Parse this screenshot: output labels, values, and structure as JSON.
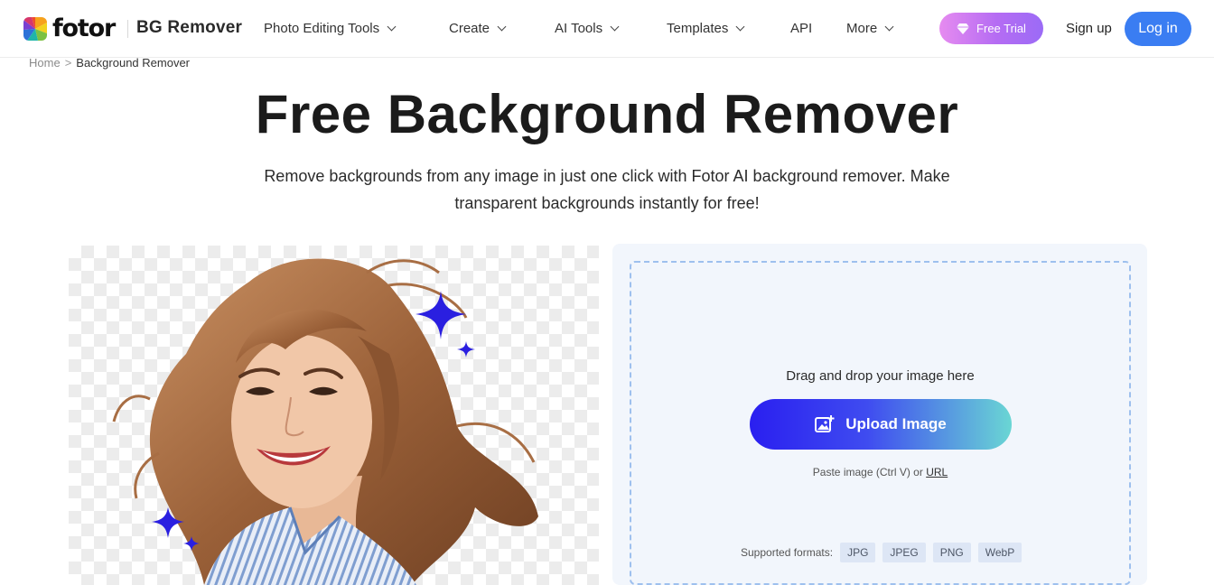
{
  "header": {
    "logo_text": "fotor",
    "product_name": "BG Remover",
    "nav": [
      {
        "label": "Photo Editing Tools",
        "has_dropdown": true
      },
      {
        "label": "Create",
        "has_dropdown": true
      },
      {
        "label": "AI Tools",
        "has_dropdown": true
      },
      {
        "label": "Templates",
        "has_dropdown": true
      },
      {
        "label": "API",
        "has_dropdown": false
      },
      {
        "label": "More",
        "has_dropdown": true
      }
    ],
    "free_trial_label": "Free Trial",
    "signup_label": "Sign up",
    "login_label": "Log in"
  },
  "breadcrumb": {
    "home": "Home",
    "separator": ">",
    "current": "Background Remover"
  },
  "hero": {
    "title": "Free Background Remover",
    "subtitle_line1": "Remove backgrounds from any image in just one click with Fotor AI background remover. Make",
    "subtitle_line2": "transparent backgrounds instantly for free!"
  },
  "upload": {
    "drag_text": "Drag and drop your image here",
    "button_label": "Upload Image",
    "paste_text": "Paste image (Ctrl V) or",
    "url_link": "URL",
    "formats_label": "Supported formats:",
    "formats": [
      "JPG",
      "JPEG",
      "PNG",
      "WebP"
    ]
  },
  "colors": {
    "login": "#3a7df2",
    "free_trial": "#c06ef2",
    "upload_start": "#2a1ff0",
    "upload_end": "#6ad6d4",
    "sparkle": "#2a1fe0"
  }
}
